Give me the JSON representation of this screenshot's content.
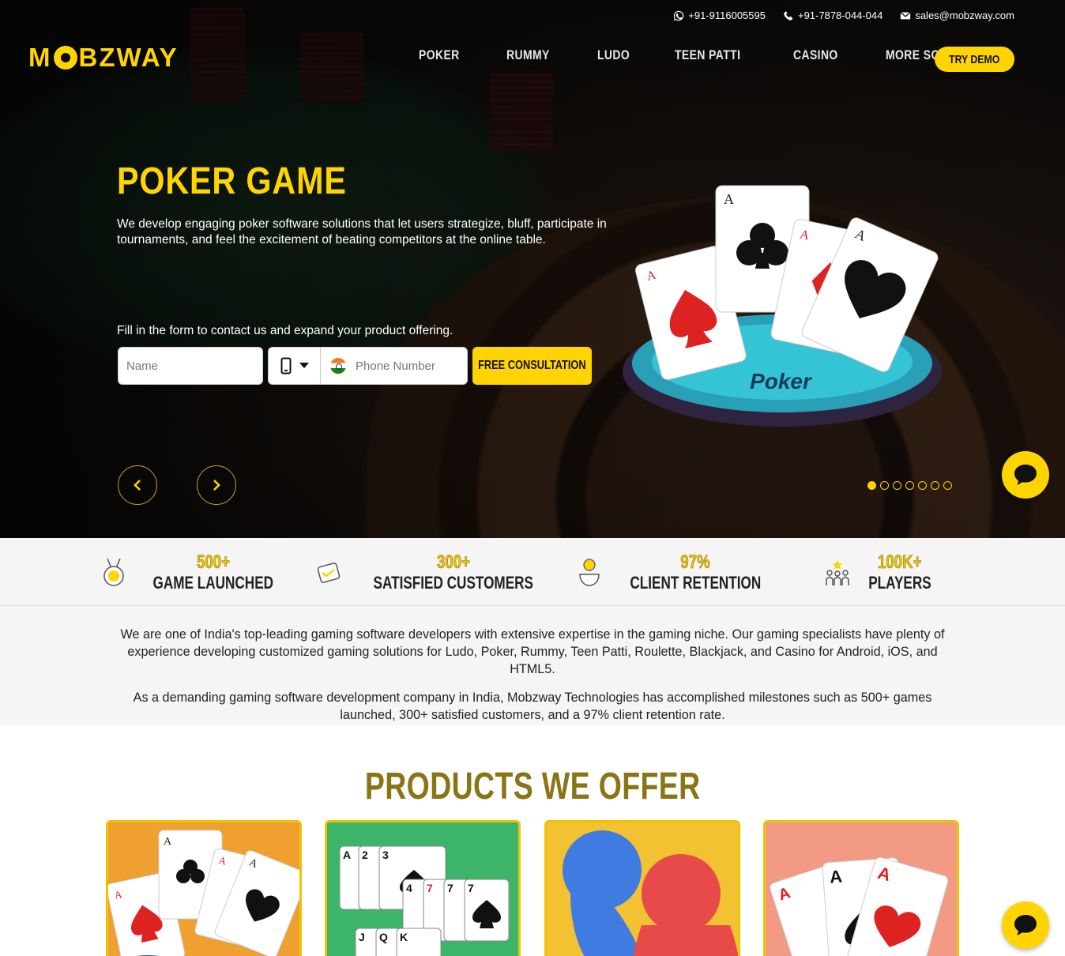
{
  "topbar": {
    "whatsapp": "+91-9116005595",
    "phone": "+91-7878-044-044",
    "email": "sales@mobzway.com"
  },
  "brand": {
    "logo_pre": "M",
    "logo_post": "BZWAY",
    "accent": "#ffd400"
  },
  "nav": {
    "items": [
      "POKER",
      "RUMMY",
      "LUDO",
      "TEEN PATTI",
      "CASINO",
      "MORE SOLUTIONS"
    ],
    "cta": "TRY DEMO"
  },
  "hero": {
    "title": "POKER GAME",
    "description": "We develop engaging poker software solutions that let users strategize, bluff, participate in tournaments, and feel the excitement of beating competitors at the online table.",
    "form_label": "Fill in the form to contact us and expand your product offering.",
    "name_placeholder": "Name",
    "phone_placeholder": "Phone Number",
    "submit": "FREE CONSULTATION",
    "table_label": "Poker",
    "slide_count": 7,
    "active_slide": 1
  },
  "stats": [
    {
      "value": "500+",
      "label": "GAME LAUNCHED",
      "icon": "medal-icon"
    },
    {
      "value": "300+",
      "label": "SATISFIED CUSTOMERS",
      "icon": "handshake-icon"
    },
    {
      "value": "97%",
      "label": "CLIENT RETENTION",
      "icon": "bulb-icon"
    },
    {
      "value": "100K+",
      "label": "PLAYERS",
      "icon": "people-icon"
    }
  ],
  "about": {
    "p1": "We are one of India's top-leading gaming software developers with extensive expertise in the gaming niche. Our gaming specialists have plenty of experience developing customized gaming solutions for Ludo, Poker, Rummy, Teen Patti, Roulette, Blackjack, and Casino for Android, iOS, and HTML5.",
    "p2": "As a demanding gaming software development company in India, Mobzway Technologies has accomplished milestones such as 500+ games launched, 300+ satisfied customers, and a 97% client retention rate."
  },
  "products": {
    "title": "PRODUCTS WE OFFER",
    "cards": [
      {
        "name": "poker",
        "bg": "#f0a030"
      },
      {
        "name": "rummy",
        "bg": "#3cb56a"
      },
      {
        "name": "ludo",
        "bg": "#f2c233"
      },
      {
        "name": "teen-patti",
        "bg": "#f39a85"
      }
    ]
  }
}
